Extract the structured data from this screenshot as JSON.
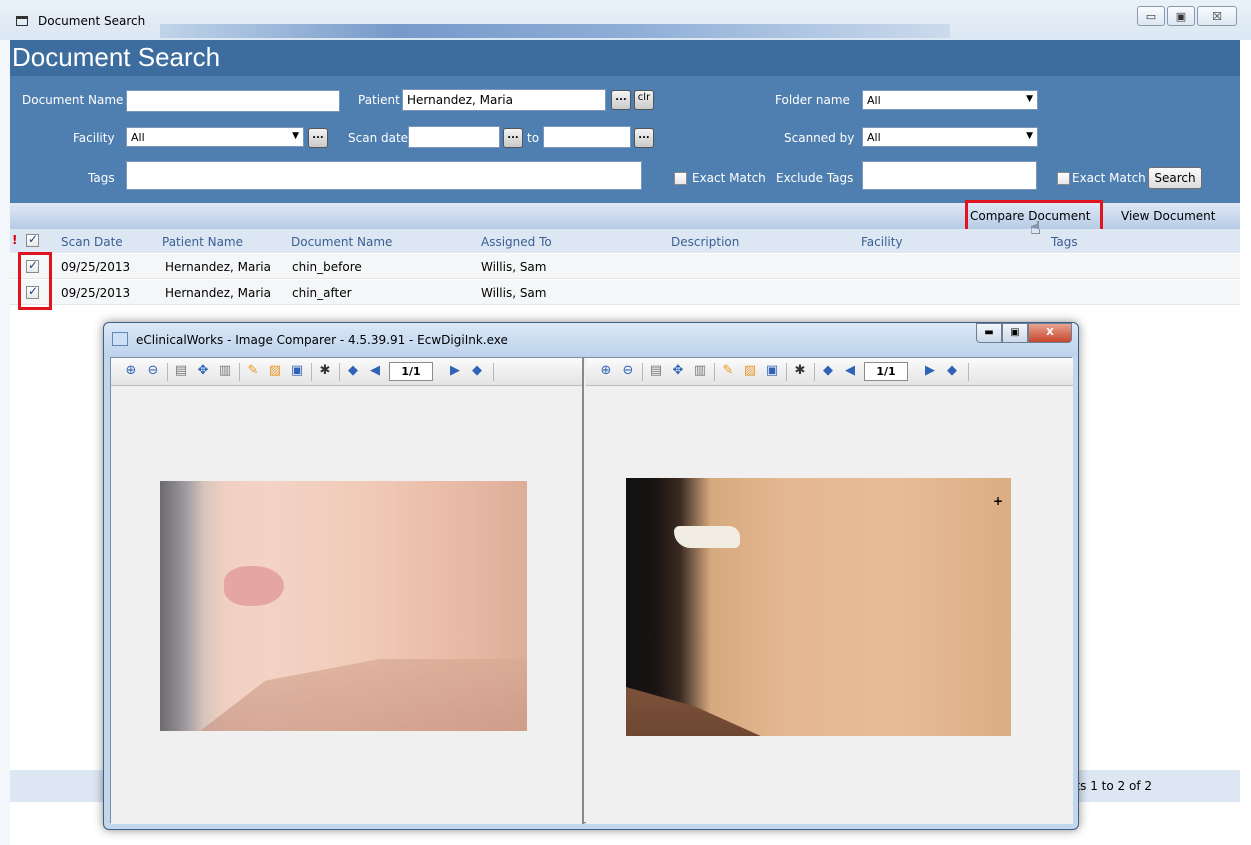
{
  "outer_window": {
    "title": "Document Search",
    "minimize": "▭",
    "maximize": "▣",
    "close": "☒"
  },
  "search": {
    "page_title": "Document Search",
    "document_name_label": "Document Name",
    "document_name_value": "",
    "patient_label": "Patient",
    "patient_value": "Hernandez, Maria",
    "patient_lookup": "...",
    "patient_clear": "clr",
    "folder_name_label": "Folder name",
    "folder_name_value": "All",
    "facility_label": "Facility",
    "facility_value": "All",
    "facility_lookup": "...",
    "scan_date_label": "Scan date",
    "scan_date_from_lookup": "...",
    "to_label": "to",
    "scan_date_to_lookup": "...",
    "scanned_by_label": "Scanned by",
    "scanned_by_value": "All",
    "tags_label": "Tags",
    "exact_match_label": "Exact Match",
    "exclude_tags_label": "Exclude Tags",
    "exact_match_2_label": "Exact Match",
    "search_button": "Search"
  },
  "actions": {
    "compare_document": "Compare Document",
    "view_document": "View Document"
  },
  "grid": {
    "alert_marker": "!",
    "columns": [
      "Scan Date",
      "Patient Name",
      "Document Name",
      "Assigned To",
      "Description",
      "Facility",
      "Tags"
    ],
    "rows": [
      {
        "scan_date": "09/25/2013",
        "patient": "Hernandez, Maria",
        "document": "chin_before",
        "assigned_to": "Willis, Sam"
      },
      {
        "scan_date": "09/25/2013",
        "patient": "Hernandez, Maria",
        "document": "chin_after",
        "assigned_to": "Willis, Sam"
      }
    ],
    "footer": "ents 1 to 2 of 2"
  },
  "comparer": {
    "title": "eClinicalWorks - Image Comparer - 4.5.39.91 - EcwDigiInk.exe",
    "left_page": "1/1",
    "right_page": "1/1",
    "minimize": "▬",
    "maximize": "▣",
    "close": "X"
  },
  "colors": {
    "header_blue": "#4f7fb0",
    "highlight_red": "#e0141e"
  }
}
